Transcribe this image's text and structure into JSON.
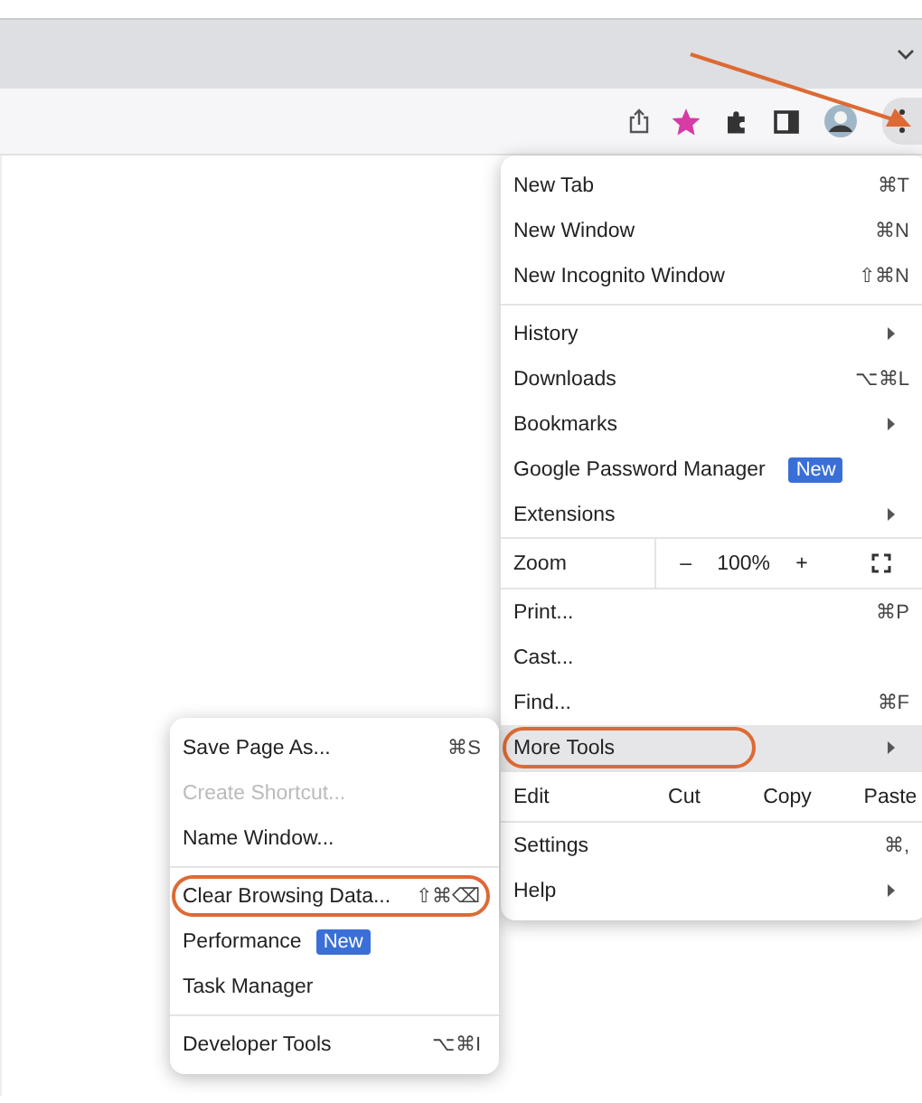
{
  "toolbar": {
    "bookmarked": true
  },
  "main_menu": {
    "items": [
      {
        "kind": "item",
        "label": "New Tab",
        "shortcut": "⌘T",
        "submenu": false,
        "selected": false,
        "circled": false
      },
      {
        "kind": "item",
        "label": "New Window",
        "shortcut": "⌘N",
        "submenu": false,
        "selected": false,
        "circled": false
      },
      {
        "kind": "item",
        "label": "New Incognito Window",
        "shortcut": "⇧⌘N",
        "submenu": false,
        "selected": false,
        "circled": false
      },
      {
        "kind": "separator"
      },
      {
        "kind": "item",
        "label": "History",
        "submenu": true,
        "selected": false,
        "circled": false
      },
      {
        "kind": "item",
        "label": "Downloads",
        "shortcut": "⌥⌘L",
        "submenu": false,
        "selected": false,
        "circled": false
      },
      {
        "kind": "item",
        "label": "Bookmarks",
        "submenu": true,
        "selected": false,
        "circled": false
      },
      {
        "kind": "item",
        "label": "Google Password Manager",
        "badge": "New",
        "submenu": false,
        "selected": false,
        "circled": false
      },
      {
        "kind": "item",
        "label": "Extensions",
        "submenu": true,
        "selected": false,
        "circled": false
      },
      {
        "kind": "zoom",
        "label": "Zoom",
        "minus": "–",
        "reading": "100%",
        "plus": "+"
      },
      {
        "kind": "item",
        "label": "Print...",
        "shortcut": "⌘P",
        "submenu": false,
        "selected": false,
        "circled": false
      },
      {
        "kind": "item",
        "label": "Cast...",
        "submenu": false,
        "selected": false,
        "circled": false
      },
      {
        "kind": "item",
        "label": "Find...",
        "shortcut": "⌘F",
        "submenu": false,
        "selected": false,
        "circled": false
      },
      {
        "kind": "item",
        "label": "More Tools",
        "submenu": true,
        "selected": true,
        "circled": true
      },
      {
        "kind": "edit",
        "label": "Edit",
        "actions": [
          "Cut",
          "Copy",
          "Paste"
        ]
      },
      {
        "kind": "item",
        "label": "Settings",
        "shortcut": "⌘,",
        "submenu": false,
        "selected": false,
        "circled": false
      },
      {
        "kind": "item",
        "label": "Help",
        "submenu": true,
        "selected": false,
        "circled": false
      }
    ]
  },
  "more_tools_menu": {
    "items": [
      {
        "kind": "item",
        "label": "Save Page As...",
        "shortcut": "⌘S",
        "disabled": false,
        "selected": false,
        "circled": false
      },
      {
        "kind": "item",
        "label": "Create Shortcut...",
        "disabled": true,
        "selected": false,
        "circled": false
      },
      {
        "kind": "item",
        "label": "Name Window...",
        "disabled": false,
        "selected": false,
        "circled": false
      },
      {
        "kind": "separator"
      },
      {
        "kind": "item",
        "label": "Clear Browsing Data...",
        "shortcut": "⇧⌘⌫",
        "disabled": false,
        "selected": false,
        "circled": true
      },
      {
        "kind": "item",
        "label": "Performance",
        "badge": "New",
        "disabled": false,
        "selected": false,
        "circled": false
      },
      {
        "kind": "item",
        "label": "Task Manager",
        "disabled": false,
        "selected": false,
        "circled": false
      },
      {
        "kind": "separator"
      },
      {
        "kind": "item",
        "label": "Developer Tools",
        "shortcut": "⌥⌘I",
        "disabled": false,
        "selected": false,
        "circled": false
      }
    ]
  }
}
